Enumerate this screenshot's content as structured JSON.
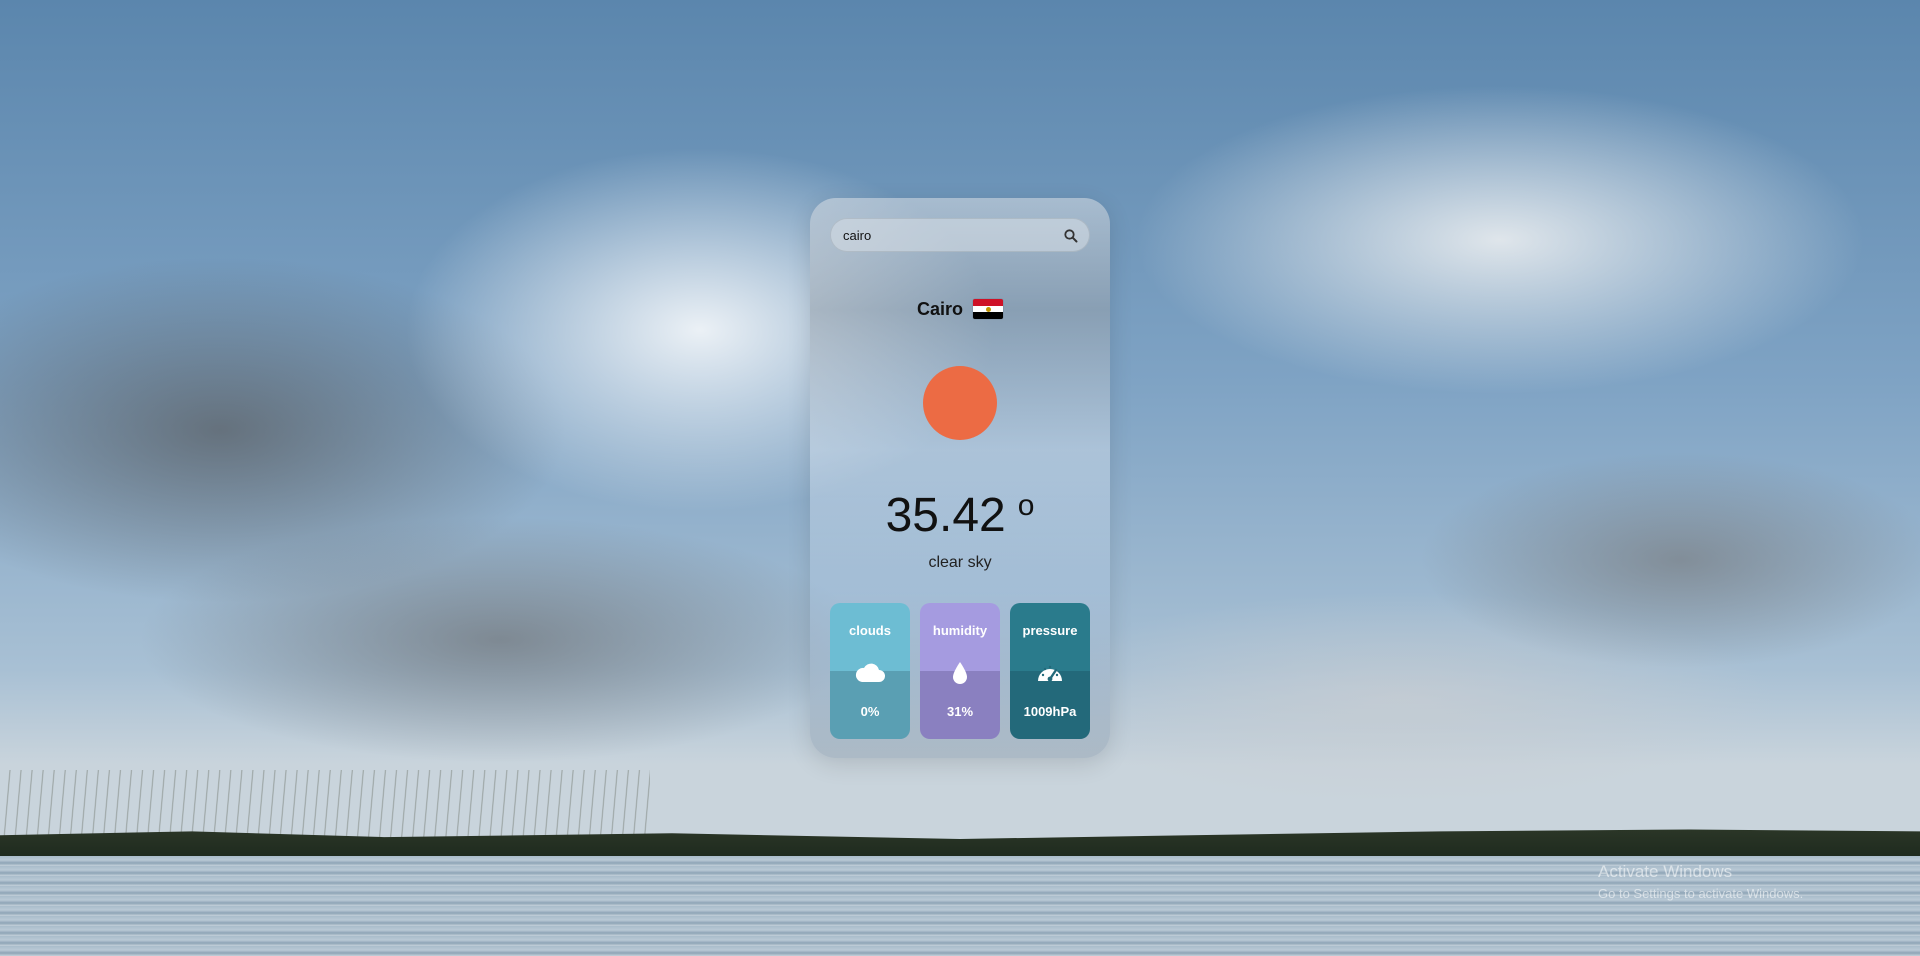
{
  "search": {
    "value": "cairo",
    "icon": "search-icon"
  },
  "location": {
    "city": "Cairo",
    "flag_icon": "egypt-flag-icon"
  },
  "weather": {
    "icon": "sun-icon",
    "temperature": "35.42",
    "degree_symbol": "o",
    "description": "clear sky"
  },
  "stats": [
    {
      "label": "clouds",
      "icon": "cloud-icon",
      "value": "0%",
      "colors": {
        "top": "#6dbdd3",
        "bottom": "#5a9fb3"
      }
    },
    {
      "label": "humidity",
      "icon": "water-drop-icon",
      "value": "31%",
      "colors": {
        "top": "#a59be0",
        "bottom": "#8a80c0"
      }
    },
    {
      "label": "pressure",
      "icon": "gauge-icon",
      "value": "1009hPa",
      "colors": {
        "top": "#2a7b8c",
        "bottom": "#23697a"
      }
    }
  ],
  "watermark": {
    "title": "Activate Windows",
    "subtitle": "Go to Settings to activate Windows."
  },
  "colors": {
    "sun": "#ec6b44"
  }
}
